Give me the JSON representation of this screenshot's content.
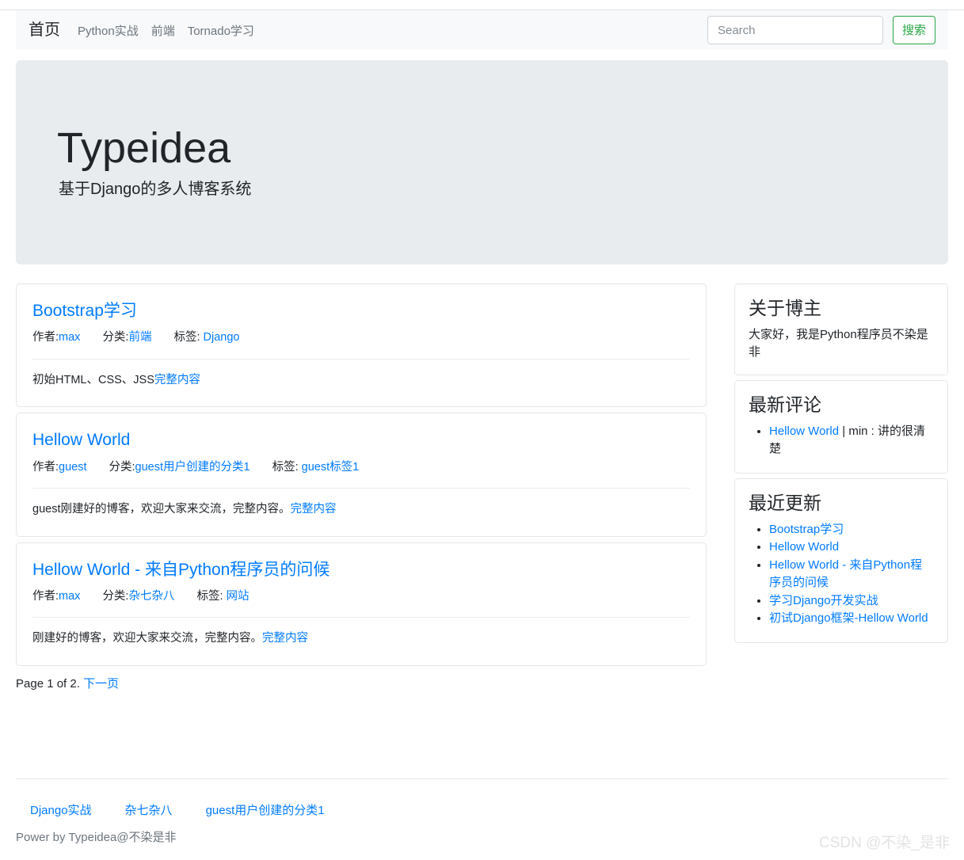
{
  "navbar": {
    "brand": "首页",
    "items": [
      {
        "label": "Python实战"
      },
      {
        "label": "前端"
      },
      {
        "label": "Tornado学习"
      }
    ],
    "search": {
      "placeholder": "Search",
      "value": "",
      "button_label": "搜索",
      "button_color": "#28a745"
    }
  },
  "jumbotron": {
    "title": "Typeidea",
    "subtitle": "基于Django的多人博客系统",
    "background": "#e9ecef"
  },
  "posts": [
    {
      "title": "Bootstrap学习",
      "author_label": "作者:",
      "author": "max",
      "category_label": "分类:",
      "category": "前端",
      "tag_label": "标签: ",
      "tag": "Django",
      "excerpt": "初始HTML、CSS、JSS",
      "more_label": "完整内容"
    },
    {
      "title": "Hellow World",
      "author_label": "作者:",
      "author": "guest",
      "category_label": "分类:",
      "category": "guest用户创建的分类1",
      "tag_label": "标签: ",
      "tag": "guest标签1",
      "excerpt": "guest刚建好的博客，欢迎大家来交流，完整内容。",
      "more_label": "完整内容"
    },
    {
      "title": "Hellow World - 来自Python程序员的问候",
      "author_label": "作者:",
      "author": "max",
      "category_label": "分类:",
      "category": "杂七杂八",
      "tag_label": "标签: ",
      "tag": "网站",
      "excerpt": "刚建好的博客，欢迎大家来交流，完整内容。",
      "more_label": "完整内容"
    }
  ],
  "pagination": {
    "status": "Page 1 of 2. ",
    "next_label": "下一页"
  },
  "sidebar": {
    "about": {
      "title": "关于博主",
      "text": "大家好，我是Python程序员不染是非"
    },
    "comments": {
      "title": "最新评论",
      "items": [
        {
          "link": "Hellow World",
          "rest": " | min : 讲的很清楚"
        }
      ]
    },
    "recent": {
      "title": "最近更新",
      "items": [
        {
          "label": "Bootstrap学习"
        },
        {
          "label": "Hellow World"
        },
        {
          "label": "Hellow World - 来自Python程序员的问候"
        },
        {
          "label": "学习Django开发实战"
        },
        {
          "label": "初试Django框架-Hellow World"
        }
      ]
    }
  },
  "footer": {
    "links": [
      {
        "label": "Django实战"
      },
      {
        "label": "杂七杂八"
      },
      {
        "label": "guest用户创建的分类1"
      }
    ],
    "copyright": "Power by Typeidea@不染是非"
  },
  "watermark": "CSDN @不染_是非",
  "accent": {
    "link": "#007bff",
    "muted": "#6c757d",
    "success": "#28a745"
  }
}
